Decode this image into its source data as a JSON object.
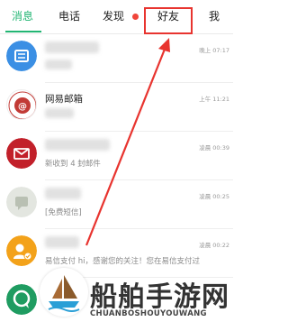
{
  "tabs": [
    {
      "label": "消息",
      "active": true
    },
    {
      "label": "电话",
      "active": false
    },
    {
      "label": "发现",
      "active": false,
      "has_dot": true
    },
    {
      "label": "好友",
      "active": false,
      "highlighted": true
    },
    {
      "label": "我",
      "active": false
    }
  ],
  "colors": {
    "accent": "#22b573",
    "badge_red": "#f0453a",
    "highlight": "#e8342f"
  },
  "chats": [
    {
      "name": "",
      "time": "晚上 07:17",
      "preview": "",
      "avatar": "folder-icon",
      "avatar_color": "#3b8fe4"
    },
    {
      "name": "网易邮箱",
      "time": "上午 11:21",
      "preview": "",
      "avatar": "mail-logo-icon",
      "avatar_color": "#c23b36"
    },
    {
      "name": "",
      "time": "凌晨 00:39",
      "preview": "新收到 4 封邮件",
      "avatar": "mail-icon",
      "avatar_color": "#c2202a"
    },
    {
      "name": "",
      "time": "凌晨 00:25",
      "preview": "[免费短信]",
      "avatar": "sms-icon",
      "avatar_color": "#e3e6e0"
    },
    {
      "name": "",
      "time": "凌晨 00:22",
      "preview": "易信支付 hi，感谢您的关注！您在易信支付过",
      "avatar": "pay-icon",
      "avatar_color": "#f3a21a"
    },
    {
      "name": "",
      "time": "",
      "preview": "",
      "avatar": "chat-bubble-icon",
      "avatar_color": "#1f9c61"
    }
  ],
  "watermark": {
    "cn": "船舶手游网",
    "en": "CHUANBOSHOUYOUWANG"
  }
}
